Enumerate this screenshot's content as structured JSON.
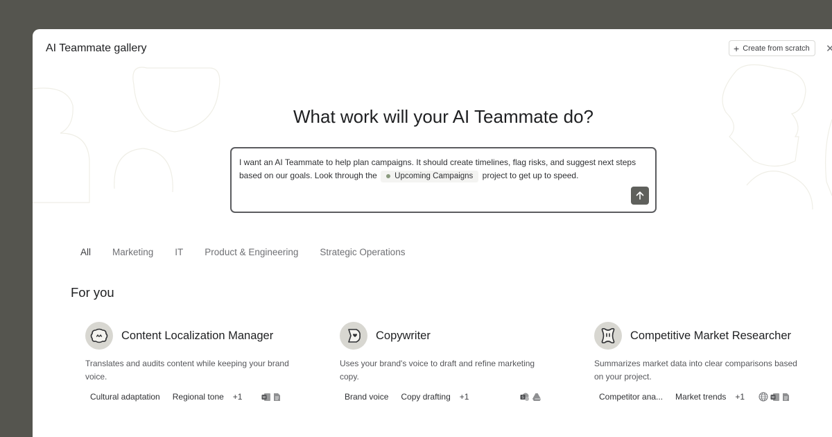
{
  "window": {
    "title": "AI Teammate gallery"
  },
  "toolbar": {
    "create_label": "Create from scratch"
  },
  "hero": {
    "headline": "What work will your AI Teammate do?",
    "prompt_before": "I want an AI Teammate to help plan campaigns. It should create timelines, flag risks, and suggest next steps based on our goals. Look through the",
    "prompt_chip": "Upcoming Campaigns",
    "prompt_after": "project to get up to speed."
  },
  "tabs": [
    {
      "label": "All",
      "active": true
    },
    {
      "label": "Marketing"
    },
    {
      "label": "IT"
    },
    {
      "label": "Product & Engineering"
    },
    {
      "label": "Strategic Operations"
    }
  ],
  "section": {
    "title": "For you"
  },
  "cards": [
    {
      "title": "Content Localization Manager",
      "desc": "Translates and audits content while keeping your brand voice.",
      "tags": [
        "Cultural adaptation",
        "Regional tone"
      ],
      "more": "+1",
      "integrations": [
        "word-doc-icon",
        "document-icon"
      ]
    },
    {
      "title": "Copywriter",
      "desc": "Uses your brand's voice to draft and refine marketing copy.",
      "tags": [
        "Brand voice",
        "Copy drafting"
      ],
      "more": "+1",
      "integrations": [
        "sharepoint-icon",
        "google-drive-icon"
      ]
    },
    {
      "title": "Competitive Market Researcher",
      "desc": "Summarizes market data into clear comparisons based on your project.",
      "tags": [
        "Competitor ana...",
        "Market trends"
      ],
      "more": "+1",
      "integrations": [
        "globe-icon",
        "word-doc-icon",
        "document-icon"
      ]
    }
  ],
  "colors": {
    "send_button": "#5f605c",
    "avatar_bg": "#d8d7d1",
    "chip_dot": "#8a9a7e"
  }
}
